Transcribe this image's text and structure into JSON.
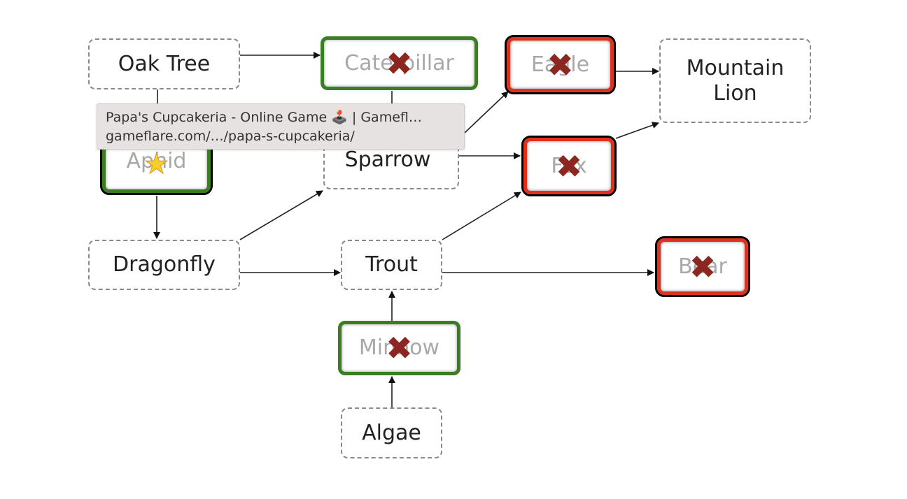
{
  "nodes": {
    "oak_tree": {
      "label": "Oak Tree",
      "state": "normal"
    },
    "caterpillar": {
      "label": "Caterpillar",
      "state": "correct-removed",
      "mark": "x-icon"
    },
    "eagle": {
      "label": "Eagle",
      "state": "wrong-removed",
      "mark": "x-icon"
    },
    "mountain_lion": {
      "label": "Mountain Lion",
      "state": "normal"
    },
    "aphid": {
      "label": "Aphid",
      "state": "selected",
      "mark": "star-icon"
    },
    "sparrow": {
      "label": "Sparrow",
      "state": "normal"
    },
    "fox": {
      "label": "Fox",
      "state": "wrong-removed",
      "mark": "x-icon"
    },
    "dragonfly": {
      "label": "Dragonfly",
      "state": "normal"
    },
    "trout": {
      "label": "Trout",
      "state": "normal"
    },
    "bear": {
      "label": "Bear",
      "state": "wrong-removed",
      "mark": "x-icon"
    },
    "minnow": {
      "label": "Minnow",
      "state": "correct-removed",
      "mark": "x-icon"
    },
    "algae": {
      "label": "Algae",
      "state": "normal"
    }
  },
  "marks": {
    "x": "✖",
    "star": "★"
  },
  "edges": [
    [
      "oak_tree",
      "caterpillar"
    ],
    [
      "oak_tree",
      "aphid"
    ],
    [
      "caterpillar",
      "sparrow"
    ],
    [
      "aphid",
      "dragonfly"
    ],
    [
      "dragonfly",
      "sparrow"
    ],
    [
      "dragonfly",
      "trout"
    ],
    [
      "sparrow",
      "eagle"
    ],
    [
      "sparrow",
      "fox"
    ],
    [
      "trout",
      "fox"
    ],
    [
      "trout",
      "bear"
    ],
    [
      "eagle",
      "mountain_lion"
    ],
    [
      "fox",
      "mountain_lion"
    ],
    [
      "minnow",
      "trout"
    ],
    [
      "algae",
      "minnow"
    ]
  ],
  "tooltip": {
    "title": "Papa's Cupcakeria - Online Game 🕹️ | Gamefl…",
    "url": "gameflare.com/…/papa-s-cupcakeria/"
  },
  "colors": {
    "correct_border": "#3a7d22",
    "wrong_border": "#e0301e",
    "x_mark": "#8b2720",
    "star": "#f5cf2a"
  }
}
